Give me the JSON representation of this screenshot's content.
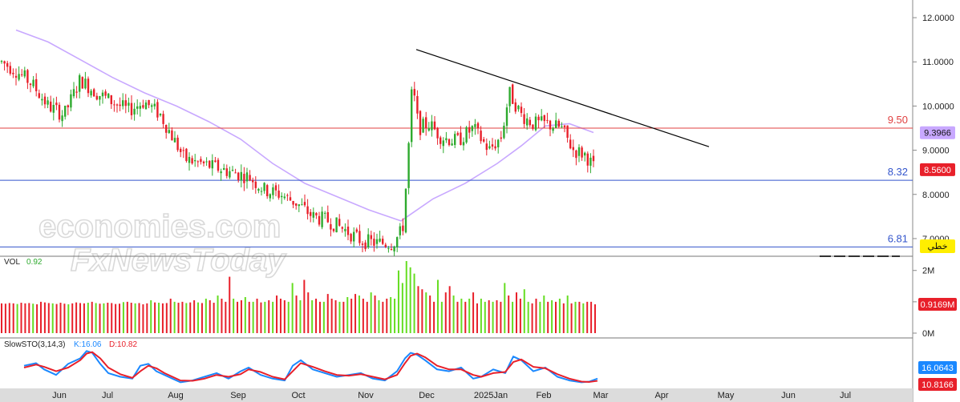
{
  "chart_data": [
    {
      "type": "candlestick",
      "title": "",
      "ylim": [
        6.6,
        12.4
      ],
      "y_ticks": [
        "12.0000",
        "11.0000",
        "10.0000",
        "9.0000",
        "8.0000",
        "7.0000"
      ],
      "x_months": [
        "Jun",
        "Jul",
        "Aug",
        "Sep",
        "Oct",
        "Nov",
        "Dec",
        "2025Jan",
        "Feb",
        "Mar",
        "Apr",
        "May",
        "Jun",
        "Jul"
      ],
      "moving_average_line": {
        "color": "#c8a8ff",
        "points": [
          [
            20,
            11.72
          ],
          [
            60,
            11.45
          ],
          [
            100,
            11.05
          ],
          [
            140,
            10.65
          ],
          [
            180,
            10.3
          ],
          [
            220,
            10.0
          ],
          [
            260,
            9.65
          ],
          [
            300,
            9.25
          ],
          [
            340,
            8.7
          ],
          [
            380,
            8.25
          ],
          [
            420,
            7.95
          ],
          [
            460,
            7.65
          ],
          [
            500,
            7.4
          ],
          [
            540,
            7.9
          ],
          [
            580,
            8.25
          ],
          [
            620,
            8.7
          ],
          [
            650,
            9.1
          ],
          [
            680,
            9.55
          ],
          [
            710,
            9.6
          ],
          [
            740,
            9.4
          ]
        ]
      },
      "horizontal_lines": [
        {
          "value": 9.5,
          "label": "9.50",
          "color": "#e04040"
        },
        {
          "value": 8.32,
          "label": "8.32",
          "color": "#3355cc"
        },
        {
          "value": 6.81,
          "label": "6.81",
          "color": "#3355cc"
        }
      ],
      "trendline": {
        "from": [
          519,
          11.28
        ],
        "to": [
          884,
          9.08
        ],
        "color": "#000000"
      },
      "price_badges": [
        {
          "value": 9.3966,
          "label": "9.3966",
          "bg": "#c8a8ff",
          "fg": "#111111"
        },
        {
          "value": 8.56,
          "label": "8.5600",
          "bg": "#e8202a",
          "fg": "#ffffff"
        }
      ],
      "tool_badge": {
        "label": "خطي",
        "bg": "#ffee00",
        "fg": "#111111"
      },
      "price_path": [
        [
          2,
          11.0
        ],
        [
          20,
          10.8
        ],
        [
          40,
          10.5
        ],
        [
          60,
          10.0
        ],
        [
          80,
          9.8
        ],
        [
          100,
          10.6
        ],
        [
          120,
          10.3
        ],
        [
          140,
          10.1
        ],
        [
          160,
          9.9
        ],
        [
          180,
          10.1
        ],
        [
          200,
          9.8
        ],
        [
          215,
          9.3
        ],
        [
          230,
          8.8
        ],
        [
          250,
          8.7
        ],
        [
          270,
          8.6
        ],
        [
          290,
          8.5
        ],
        [
          310,
          8.4
        ],
        [
          330,
          8.1
        ],
        [
          350,
          8.0
        ],
        [
          370,
          7.8
        ],
        [
          390,
          7.5
        ],
        [
          410,
          7.4
        ],
        [
          430,
          7.2
        ],
        [
          450,
          6.95
        ],
        [
          470,
          6.9
        ],
        [
          490,
          6.9
        ],
        [
          502,
          7.2
        ],
        [
          508,
          8.6
        ],
        [
          514,
          10.5
        ],
        [
          522,
          9.5
        ],
        [
          535,
          9.6
        ],
        [
          550,
          9.3
        ],
        [
          570,
          9.2
        ],
        [
          590,
          9.5
        ],
        [
          610,
          9.0
        ],
        [
          625,
          9.3
        ],
        [
          635,
          10.3
        ],
        [
          650,
          9.8
        ],
        [
          665,
          9.6
        ],
        [
          680,
          9.6
        ],
        [
          700,
          9.5
        ],
        [
          715,
          9.0
        ],
        [
          730,
          8.9
        ],
        [
          742,
          8.56
        ]
      ],
      "watermark": [
        "economies.com",
        "FxNewsToday"
      ]
    },
    {
      "type": "bar",
      "title": "VOL",
      "value_label": "0.92",
      "y_ticks": [
        "2M",
        "1M",
        "0M"
      ],
      "ylim": [
        0,
        2.3
      ],
      "last_value_badge": {
        "label": "0.9169M",
        "bg": "#e8202a",
        "fg": "#ffffff"
      },
      "values": [
        0.95,
        0.94,
        0.96,
        0.95,
        0.93,
        0.97,
        0.95,
        0.96,
        0.94,
        0.92,
        1.0,
        0.98,
        0.96,
        0.95,
        0.93,
        0.97,
        0.94,
        0.92,
        0.95,
        0.98,
        0.96,
        0.95,
        0.97,
        1.0,
        0.96,
        0.94,
        0.95,
        0.97,
        0.96,
        0.93,
        0.94,
        0.99,
        1.0,
        0.97,
        0.95,
        0.96,
        0.92,
        0.95,
        1.05,
        0.98,
        0.97,
        0.95,
        0.96,
        1.1,
        1.0,
        0.97,
        1.0,
        0.96,
        0.98,
        1.05,
        0.98,
        0.96,
        1.1,
        1.05,
        0.97,
        1.2,
        1.1,
        1.0,
        1.8,
        1.1,
        1.0,
        1.05,
        1.15,
        1.0,
        1.0,
        1.1,
        0.98,
        1.0,
        1.05,
        1.0,
        1.2,
        1.1,
        1.05,
        1.0,
        1.6,
        1.2,
        1.05,
        1.7,
        1.3,
        1.05,
        1.1,
        1.0,
        1.0,
        1.25,
        1.1,
        1.05,
        1.0,
        1.0,
        1.15,
        1.1,
        1.25,
        1.2,
        1.1,
        1.0,
        1.3,
        1.2,
        1.05,
        1.0,
        1.1,
        1.15,
        1.1,
        2.0,
        1.6,
        2.3,
        2.1,
        1.9,
        1.5,
        1.4,
        1.3,
        1.2,
        1.0,
        1.7,
        1.0,
        1.3,
        1.5,
        1.2,
        1.0,
        1.1,
        1.0,
        1.1,
        1.3,
        0.95,
        1.1,
        1.0,
        1.05,
        1.0,
        1.05,
        1.0,
        1.6,
        1.2,
        1.0,
        1.3,
        1.1,
        1.4,
        1.0,
        0.95,
        1.1,
        1.0,
        1.2,
        1.0,
        1.05,
        1.0,
        1.1,
        0.95,
        1.2,
        0.95,
        1.0,
        1.0,
        0.95,
        1.0,
        1.0,
        0.92
      ],
      "colors": [
        "red",
        "red",
        "red",
        "red",
        "green",
        "red",
        "red",
        "red",
        "green",
        "red",
        "red",
        "red",
        "red",
        "green",
        "red",
        "red",
        "red",
        "green",
        "red",
        "red",
        "red",
        "red",
        "green",
        "red",
        "green",
        "red",
        "green",
        "red",
        "red",
        "red",
        "red",
        "green",
        "red",
        "red",
        "green",
        "red",
        "red",
        "red",
        "green",
        "red",
        "green",
        "red",
        "red",
        "red",
        "green",
        "red",
        "red",
        "green",
        "red",
        "red",
        "green",
        "red",
        "green",
        "red",
        "red",
        "green",
        "red",
        "red",
        "red",
        "green",
        "red",
        "red",
        "green",
        "red",
        "green",
        "red",
        "red",
        "green",
        "red",
        "green",
        "red",
        "red",
        "red",
        "green",
        "green",
        "red",
        "green",
        "red",
        "red",
        "green",
        "red",
        "red",
        "green",
        "red",
        "red",
        "red",
        "green",
        "red",
        "green",
        "red",
        "red",
        "green",
        "red",
        "red",
        "green",
        "red",
        "green",
        "red",
        "red",
        "green",
        "green",
        "green",
        "green",
        "green",
        "green",
        "green",
        "red",
        "red",
        "green",
        "red",
        "red",
        "green",
        "green",
        "red",
        "red",
        "green",
        "red",
        "green",
        "red",
        "green",
        "red",
        "red",
        "green",
        "green",
        "red",
        "green",
        "red",
        "red",
        "green",
        "red",
        "green",
        "red",
        "red",
        "green",
        "green",
        "red",
        "red",
        "green",
        "green",
        "red",
        "green",
        "red",
        "green",
        "red",
        "green",
        "red",
        "green",
        "red",
        "green",
        "red",
        "red",
        "red",
        "red"
      ]
    },
    {
      "type": "line",
      "title": "SlowSTO(3,14,3)",
      "k_label": "K:16.06",
      "d_label": "D:10.82",
      "ylim": [
        0,
        100
      ],
      "k_badge": {
        "label": "16.0643",
        "bg": "#1a88ff",
        "fg": "#ffffff"
      },
      "d_badge": {
        "label": "10.8166",
        "bg": "#e8202a",
        "fg": "#ffffff"
      },
      "series": [
        {
          "name": "K",
          "color": "#1a88ff",
          "x": [
            30,
            45,
            55,
            70,
            85,
            100,
            108,
            115,
            125,
            135,
            150,
            165,
            175,
            185,
            195,
            205,
            215,
            225,
            240,
            255,
            270,
            285,
            300,
            310,
            325,
            340,
            355,
            365,
            375,
            390,
            405,
            420,
            435,
            450,
            465,
            480,
            495,
            505,
            512,
            520,
            530,
            545,
            560,
            575,
            590,
            600,
            615,
            630,
            640,
            650,
            665,
            680,
            695,
            710,
            725,
            735,
            745
          ],
          "y": [
            55,
            62,
            45,
            30,
            60,
            75,
            95,
            90,
            60,
            35,
            25,
            20,
            55,
            60,
            40,
            30,
            20,
            10,
            15,
            25,
            35,
            20,
            40,
            50,
            30,
            20,
            15,
            55,
            70,
            45,
            35,
            25,
            30,
            35,
            20,
            15,
            40,
            75,
            90,
            85,
            70,
            45,
            40,
            50,
            20,
            25,
            45,
            35,
            80,
            70,
            40,
            50,
            25,
            15,
            10,
            12,
            20
          ]
        },
        {
          "name": "D",
          "color": "#e8202a",
          "x": [
            30,
            45,
            55,
            70,
            85,
            100,
            108,
            115,
            125,
            135,
            150,
            165,
            175,
            185,
            195,
            205,
            215,
            225,
            240,
            255,
            270,
            285,
            300,
            310,
            325,
            340,
            355,
            365,
            375,
            390,
            405,
            420,
            435,
            450,
            465,
            480,
            495,
            505,
            512,
            520,
            530,
            545,
            560,
            575,
            590,
            600,
            615,
            630,
            640,
            650,
            665,
            680,
            695,
            710,
            725,
            735,
            745
          ],
          "y": [
            50,
            58,
            52,
            40,
            50,
            70,
            88,
            92,
            75,
            50,
            32,
            22,
            40,
            55,
            48,
            35,
            25,
            15,
            14,
            20,
            30,
            25,
            32,
            45,
            38,
            25,
            18,
            40,
            62,
            52,
            40,
            30,
            28,
            32,
            25,
            18,
            30,
            62,
            82,
            88,
            78,
            55,
            45,
            45,
            30,
            25,
            35,
            38,
            65,
            72,
            52,
            48,
            32,
            20,
            12,
            11,
            14
          ]
        }
      ]
    }
  ]
}
